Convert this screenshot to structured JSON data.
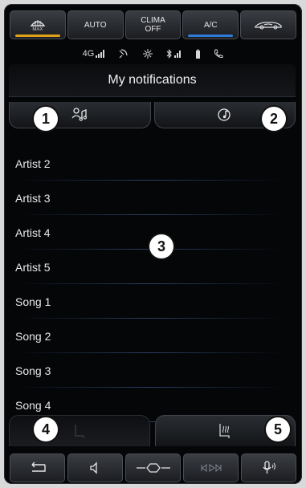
{
  "climate": {
    "buttons": [
      {
        "label": "",
        "sub": "MAX",
        "icon": "max-defrost-icon"
      },
      {
        "label": "AUTO"
      },
      {
        "label": "CLIMA\nOFF"
      },
      {
        "label": "A/C"
      },
      {
        "label": "",
        "icon": "recirculation-icon"
      }
    ]
  },
  "status": {
    "network": "4G",
    "icons": [
      "signal-icon",
      "satellite-icon",
      "bluetooth-icon",
      "battery-icon",
      "phone-icon"
    ]
  },
  "header": {
    "title": "My notifications"
  },
  "tabs": [
    {
      "icon": "artist-music-icon"
    },
    {
      "icon": "song-music-icon"
    }
  ],
  "callouts": [
    "1",
    "2",
    "3",
    "4",
    "5"
  ],
  "list": {
    "items": [
      "Artist 2",
      "Artist 3",
      "Artist 4",
      "Artist 5",
      "Song 1",
      "Song 2",
      "Song 3",
      "Song 4"
    ]
  },
  "bottom_tabs": [
    {
      "icon": "seat-icon"
    },
    {
      "icon": "seat-heat-icon"
    }
  ],
  "bottom_bar": {
    "buttons": [
      {
        "icon": "back-arrow-icon"
      },
      {
        "icon": "volume-icon"
      },
      {
        "icon": "home-icon"
      },
      {
        "icon": "media-skip-icon"
      },
      {
        "icon": "voice-command-icon"
      }
    ]
  },
  "colors": {
    "accent_amber": "#e0a21a",
    "accent_blue": "#2f7bd8",
    "background": "#050608"
  }
}
